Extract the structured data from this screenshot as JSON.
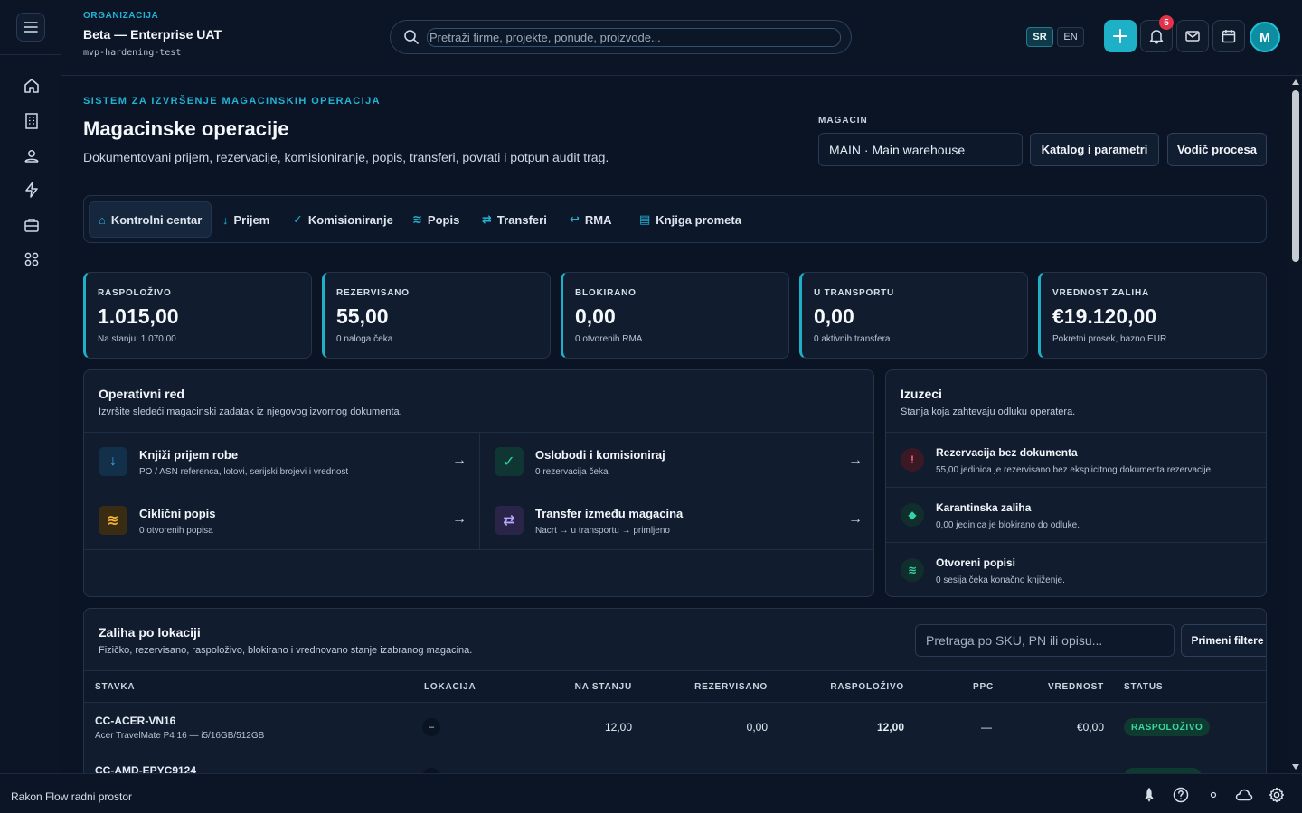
{
  "header": {
    "org_label": "ORGANIZACIJA",
    "org_name": "Beta — Enterprise UAT",
    "org_slug": "mvp-hardening-test",
    "search_placeholder": "Pretraži firme, projekte, ponude, proizvode...",
    "lang_sr": "SR",
    "lang_en": "EN",
    "notification_count": "5",
    "avatar_initial": "M"
  },
  "sidebar": {
    "items": [
      {
        "icon": "home-icon"
      },
      {
        "icon": "building-icon"
      },
      {
        "icon": "users-icon"
      },
      {
        "icon": "bolt-icon"
      },
      {
        "icon": "briefcase-icon"
      },
      {
        "icon": "apps-grid-icon"
      }
    ]
  },
  "page": {
    "eyebrow": "SISTEM ZA IZVRŠENJE MAGACINSKIH OPERACIJA",
    "title": "Magacinske operacije",
    "description": "Dokumentovani prijem, rezervacije, komisioniranje, popis, transferi, povrati i potpun audit trag.",
    "warehouse_label": "MAGACIN",
    "warehouse_value": "MAIN · Main warehouse",
    "catalog_button": "Katalog i parametri",
    "guide_button": "Vodič procesa"
  },
  "tabs": [
    {
      "icon": "⌂",
      "label": "Kontrolni centar",
      "active": true
    },
    {
      "icon": "↓",
      "label": "Prijem"
    },
    {
      "icon": "✓",
      "label": "Komisioniranje"
    },
    {
      "icon": "≋",
      "label": "Popis"
    },
    {
      "icon": "⇄",
      "label": "Transferi"
    },
    {
      "icon": "↩",
      "label": "RMA"
    },
    {
      "icon": "▤",
      "label": "Knjiga prometa"
    }
  ],
  "kpis": [
    {
      "label": "RASPOLOŽIVO",
      "value": "1.015,00",
      "sub": "Na stanju: 1.070,00"
    },
    {
      "label": "REZERVISANO",
      "value": "55,00",
      "sub": "0 naloga čeka"
    },
    {
      "label": "BLOKIRANO",
      "value": "0,00",
      "sub": "0 otvorenih RMA"
    },
    {
      "label": "U TRANSPORTU",
      "value": "0,00",
      "sub": "0 aktivnih transfera"
    },
    {
      "label": "VREDNOST ZALIHA",
      "value": "€19.120,00",
      "sub": "Pokretni prosek, bazno EUR"
    }
  ],
  "operations": {
    "title": "Operativni red",
    "subtitle": "Izvršite sledeći magacinski zadatak iz njegovog izvornog dokumenta.",
    "tasks": [
      {
        "icon": "↓",
        "title": "Knjiži prijem robe",
        "sub": "PO / ASN referenca, lotovi, serijski brojevi i vrednost",
        "arrow": "→",
        "color": "#3aa6e8",
        "bg": "#12304a"
      },
      {
        "icon": "✓",
        "title": "Oslobodi i komisioniraj",
        "sub": "0 rezervacija čeka",
        "arrow": "→",
        "color": "#35d4a4",
        "bg": "#0f3632"
      },
      {
        "icon": "≋",
        "title": "Ciklični popis",
        "sub": "0 otvorenih popisa",
        "arrow": "→",
        "color": "#f2b233",
        "bg": "#3a2c12"
      },
      {
        "icon": "⇄",
        "title": "Transfer između magacina",
        "sub": "Nacrt → u transportu → primljeno",
        "arrow": "→",
        "color": "#b8a6ff",
        "bg": "#2a2448"
      }
    ]
  },
  "exceptions": {
    "title": "Izuzeci",
    "subtitle": "Stanja koja zahtevaju odluku operatera.",
    "items": [
      {
        "icon": "!",
        "title": "Rezervacija bez dokumenta",
        "sub": "55,00 jedinica je rezervisano bez eksplicitnog dokumenta rezervacije.",
        "color": "#ff5d73",
        "bg": "#3a1824"
      },
      {
        "icon": "◆",
        "title": "Karantinska zaliha",
        "sub": "0,00 jedinica je blokirano do odluke.",
        "color": "#35d4a4",
        "bg": "#0f2e2c"
      },
      {
        "icon": "≋",
        "title": "Otvoreni popisi",
        "sub": "0 sesija čeka konačno knjiženje.",
        "color": "#35d4a4",
        "bg": "#0f2e2c"
      }
    ]
  },
  "stock": {
    "title": "Zaliha po lokaciji",
    "subtitle": "Fizičko, rezervisano, raspoloživo, blokirano i vrednovano stanje izabranog magacina.",
    "search_placeholder": "Pretraga po SKU, PN ili opisu...",
    "apply_button": "Primeni filtere",
    "columns": [
      "STAVKA",
      "LOKACIJA",
      "NA STANJU",
      "REZERVISANO",
      "RASPOLOŽIVO",
      "PPC",
      "VREDNOST",
      "STATUS"
    ],
    "rows": [
      {
        "sku": "CC-ACER-VN16",
        "desc": "Acer TravelMate P4 16 — i5/16GB/512GB",
        "location": "–",
        "on_hand": "12,00",
        "reserved": "0,00",
        "available": "12,00",
        "ppc": "—",
        "value": "€0,00",
        "status": "RASPOLOŽIVO"
      },
      {
        "sku": "CC-AMD-EPYC9124",
        "desc": "",
        "location": "",
        "on_hand": "",
        "reserved": "",
        "available": "",
        "ppc": "",
        "value": "",
        "status": ""
      }
    ]
  },
  "footer": {
    "text": "Rakon Flow radni prostor"
  }
}
